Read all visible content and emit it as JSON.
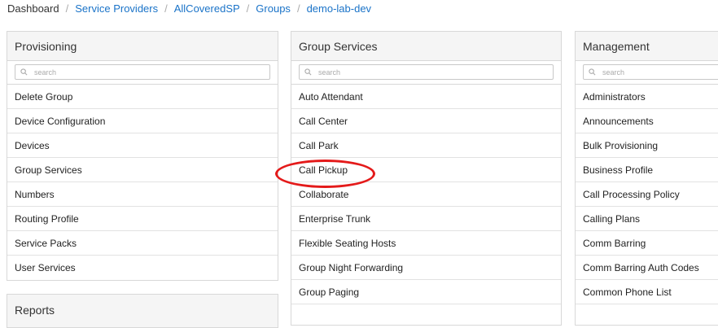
{
  "breadcrumb": {
    "items": [
      "Dashboard",
      "Service Providers",
      "AllCoveredSP",
      "Groups",
      "demo-lab-dev"
    ],
    "separator": "/"
  },
  "search_placeholder": "search",
  "panels": [
    {
      "title": "Provisioning",
      "items": [
        "Delete Group",
        "Device Configuration",
        "Devices",
        "Group Services",
        "Numbers",
        "Routing Profile",
        "Service Packs",
        "User Services"
      ]
    },
    {
      "title": "Group Services",
      "items": [
        "Auto Attendant",
        "Call Center",
        "Call Park",
        "Call Pickup",
        "Collaborate",
        "Enterprise Trunk",
        "Flexible Seating Hosts",
        "Group Night Forwarding",
        "Group Paging"
      ]
    },
    {
      "title": "Management",
      "items": [
        "Administrators",
        "Announcements",
        "Bulk Provisioning",
        "Business Profile",
        "Call Processing Policy",
        "Calling Plans",
        "Comm Barring",
        "Comm Barring Auth Codes",
        "Common Phone List"
      ]
    }
  ],
  "reports": {
    "title": "Reports"
  },
  "colors": {
    "link": "#1a73c8",
    "highlight": "#e41a1a"
  }
}
